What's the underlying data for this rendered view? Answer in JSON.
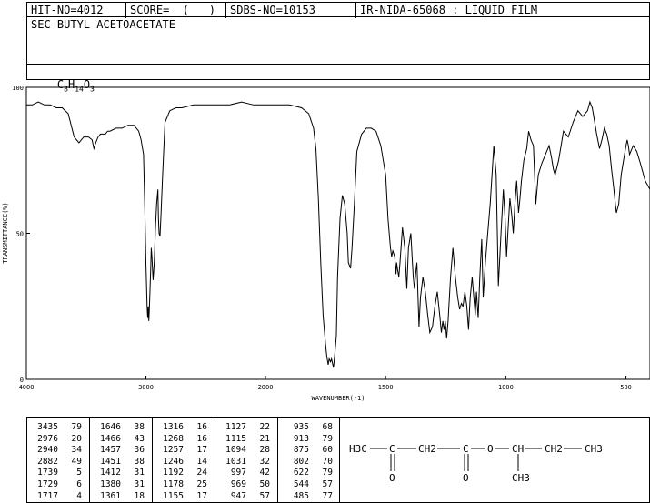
{
  "header": {
    "hit_no": "HIT-NO=4012",
    "score": "SCORE=  (   )",
    "sdbs_no": "SDBS-NO=10153",
    "ir_nida": "IR-NIDA-65068 : LIQUID FILM"
  },
  "compound": {
    "name": "SEC-BUTYL ACETOACETATE",
    "formula_parts": [
      "C",
      "8",
      "H",
      "14",
      "O",
      "3"
    ]
  },
  "peak_columns": [
    [
      [
        "3435",
        "79"
      ],
      [
        "2976",
        "20"
      ],
      [
        "2940",
        "34"
      ],
      [
        "2882",
        "49"
      ],
      [
        "1739",
        "5"
      ],
      [
        "1729",
        "6"
      ],
      [
        "1717",
        "4"
      ]
    ],
    [
      [
        "1646",
        "38"
      ],
      [
        "1466",
        "43"
      ],
      [
        "1457",
        "36"
      ],
      [
        "1451",
        "38"
      ],
      [
        "1412",
        "31"
      ],
      [
        "1380",
        "31"
      ],
      [
        "1361",
        "18"
      ]
    ],
    [
      [
        "1316",
        "16"
      ],
      [
        "1268",
        "16"
      ],
      [
        "1257",
        "17"
      ],
      [
        "1246",
        "14"
      ],
      [
        "1192",
        "24"
      ],
      [
        "1178",
        "25"
      ],
      [
        "1155",
        "17"
      ]
    ],
    [
      [
        "1127",
        "22"
      ],
      [
        "1115",
        "21"
      ],
      [
        "1094",
        "28"
      ],
      [
        "1031",
        "32"
      ],
      [
        "997",
        "42"
      ],
      [
        "969",
        "50"
      ],
      [
        "947",
        "57"
      ]
    ],
    [
      [
        "935",
        "68"
      ],
      [
        "913",
        "79"
      ],
      [
        "875",
        "60"
      ],
      [
        "802",
        "70"
      ],
      [
        "622",
        "79"
      ],
      [
        "544",
        "57"
      ],
      [
        "485",
        "77"
      ]
    ]
  ],
  "structure": {
    "atoms": [
      "H3C",
      "C",
      "CH2",
      "C",
      "O",
      "CH",
      "CH2",
      "CH3",
      "O",
      "O",
      "CH3"
    ]
  },
  "chart_data": {
    "type": "line",
    "xlabel": "WAVENUMBER(-1)",
    "ylabel": "TRANSMITTANCE(%)",
    "xlim": [
      4000,
      400
    ],
    "ylim": [
      0,
      100
    ],
    "x_ticks": [
      4000,
      3000,
      2000,
      1500,
      1000,
      500
    ],
    "x_tick_labels": [
      "4000",
      "3000",
      "2000",
      "1500",
      "1000",
      "500"
    ],
    "y_ticks": [
      0,
      50,
      100
    ],
    "y_tick_labels": [
      "0",
      "50",
      "100"
    ],
    "grid": false,
    "series": [
      {
        "x": [
          4000,
          3950,
          3900,
          3850,
          3800,
          3750,
          3700,
          3650,
          3600,
          3560,
          3520,
          3480,
          3450,
          3435,
          3420,
          3400,
          3380,
          3360,
          3340,
          3320,
          3300,
          3250,
          3200,
          3150,
          3100,
          3060,
          3040,
          3020,
          3010,
          3000,
          2990,
          2985,
          2980,
          2976,
          2970,
          2960,
          2955,
          2950,
          2940,
          2930,
          2920,
          2910,
          2900,
          2895,
          2890,
          2882,
          2875,
          2860,
          2840,
          2800,
          2750,
          2700,
          2600,
          2500,
          2400,
          2300,
          2200,
          2100,
          2000,
          1950,
          1900,
          1850,
          1820,
          1800,
          1790,
          1780,
          1770,
          1760,
          1750,
          1745,
          1739,
          1735,
          1729,
          1725,
          1717,
          1712,
          1705,
          1700,
          1690,
          1680,
          1670,
          1660,
          1655,
          1646,
          1640,
          1630,
          1620,
          1600,
          1580,
          1560,
          1540,
          1520,
          1500,
          1490,
          1480,
          1475,
          1470,
          1466,
          1462,
          1457,
          1454,
          1451,
          1445,
          1440,
          1430,
          1420,
          1412,
          1405,
          1395,
          1390,
          1385,
          1380,
          1375,
          1370,
          1361,
          1355,
          1345,
          1335,
          1325,
          1316,
          1305,
          1295,
          1285,
          1275,
          1268,
          1262,
          1257,
          1252,
          1246,
          1240,
          1230,
          1220,
          1210,
          1200,
          1192,
          1185,
          1178,
          1170,
          1162,
          1155,
          1148,
          1140,
          1135,
          1127,
          1122,
          1115,
          1108,
          1100,
          1094,
          1085,
          1075,
          1065,
          1050,
          1040,
          1031,
          1020,
          1010,
          1003,
          997,
          990,
          983,
          975,
          969,
          962,
          955,
          947,
          941,
          935,
          925,
          913,
          905,
          895,
          885,
          875,
          865,
          850,
          835,
          820,
          810,
          802,
          795,
          780,
          770,
          760,
          740,
          720,
          700,
          680,
          660,
          650,
          640,
          630,
          622,
          610,
          600,
          590,
          580,
          570,
          560,
          550,
          544,
          540,
          530,
          520,
          510,
          500,
          495,
          490,
          485,
          470,
          455,
          440,
          420,
          400
        ],
        "y": [
          94,
          94,
          95,
          94,
          94,
          93,
          93,
          91,
          83,
          81,
          83,
          83,
          82,
          79,
          81,
          83,
          84,
          84,
          84,
          85,
          85,
          86,
          86,
          87,
          87,
          85,
          82,
          77,
          60,
          40,
          25,
          21,
          25,
          20,
          25,
          38,
          45,
          42,
          34,
          40,
          52,
          60,
          65,
          55,
          50,
          49,
          55,
          70,
          88,
          92,
          93,
          93,
          94,
          94,
          94,
          94,
          95,
          94,
          94,
          94,
          94,
          93,
          91,
          86,
          79,
          62,
          40,
          22,
          12,
          8,
          5,
          7,
          6,
          7,
          4,
          8,
          15,
          35,
          55,
          63,
          60,
          50,
          40,
          38,
          45,
          60,
          78,
          84,
          86,
          86,
          85,
          80,
          70,
          55,
          45,
          42,
          44,
          43,
          42,
          36,
          40,
          38,
          35,
          40,
          52,
          45,
          31,
          45,
          50,
          42,
          35,
          31,
          36,
          40,
          18,
          28,
          35,
          30,
          22,
          16,
          18,
          25,
          30,
          22,
          16,
          20,
          17,
          20,
          14,
          20,
          35,
          45,
          35,
          28,
          24,
          26,
          25,
          30,
          25,
          17,
          28,
          35,
          30,
          22,
          30,
          21,
          35,
          48,
          28,
          40,
          50,
          60,
          80,
          70,
          32,
          50,
          65,
          55,
          42,
          52,
          62,
          56,
          50,
          60,
          68,
          57,
          62,
          68,
          75,
          79,
          85,
          82,
          80,
          60,
          70,
          74,
          77,
          80,
          76,
          72,
          70,
          75,
          80,
          85,
          83,
          88,
          92,
          90,
          92,
          95,
          93,
          88,
          84,
          79,
          82,
          86,
          84,
          80,
          72,
          65,
          60,
          57,
          60,
          70,
          75,
          80,
          82,
          80,
          77,
          80,
          78,
          74,
          68,
          65
        ]
      }
    ]
  }
}
